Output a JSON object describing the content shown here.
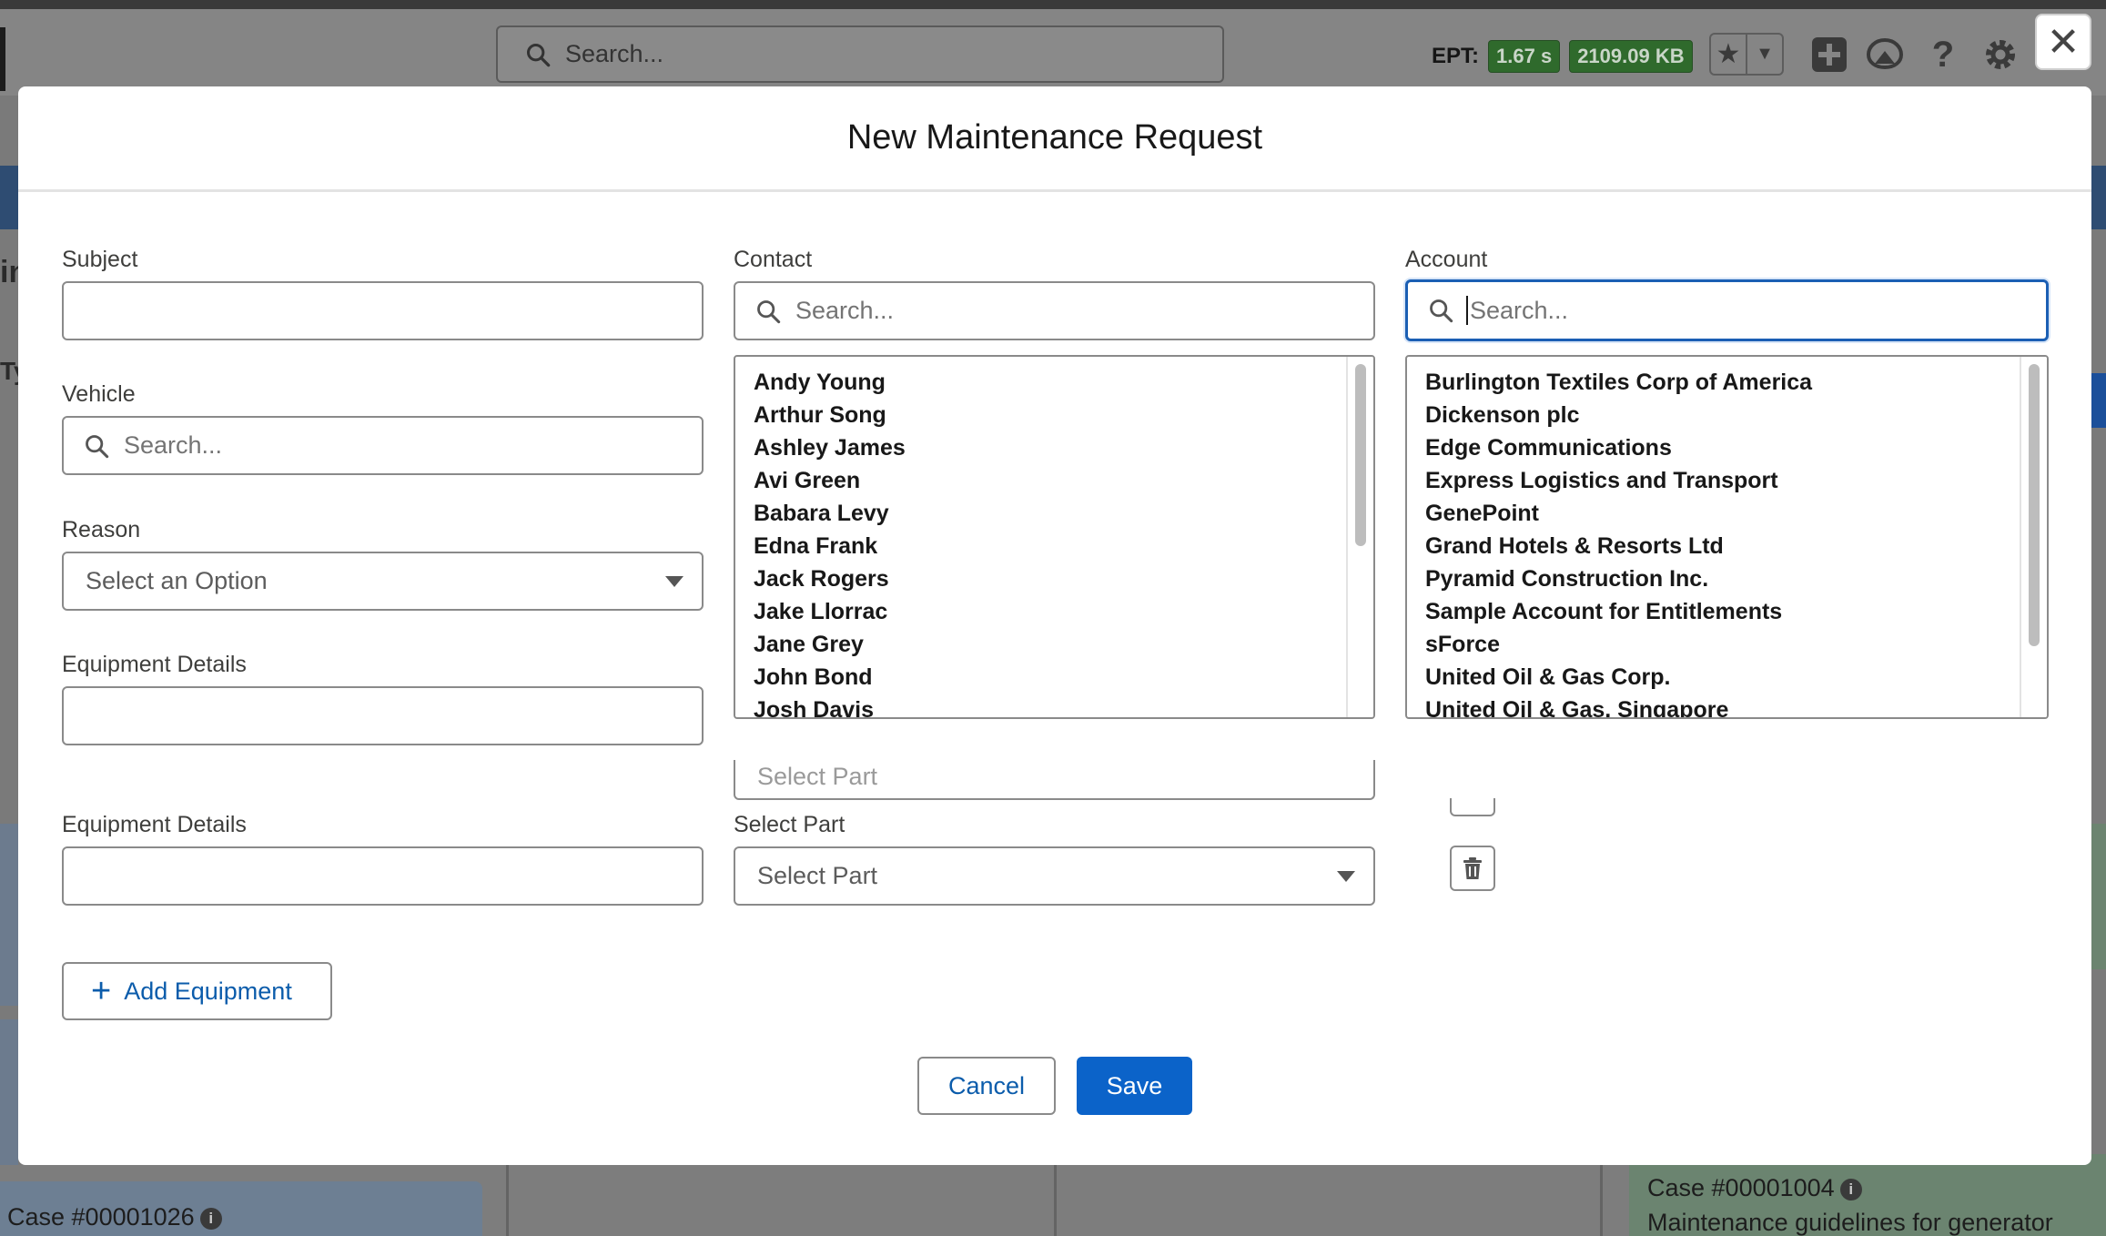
{
  "header": {
    "search_placeholder": "Search...",
    "ept_label": "EPT:",
    "ept_time": "1.67 s",
    "ept_size": "2109.09 KB"
  },
  "background": {
    "left_text_1": "in",
    "left_text_2": "Ty",
    "case_left": "Case #00001026",
    "case_right": "Case #00001004",
    "case_right_desc": "Maintenance guidelines for generator"
  },
  "modal": {
    "title": "New Maintenance Request",
    "subject_label": "Subject",
    "subject_value": "",
    "contact_label": "Contact",
    "contact_placeholder": "Search...",
    "account_label": "Account",
    "account_placeholder": "Search...",
    "vehicle_label": "Vehicle",
    "vehicle_placeholder": "Search...",
    "reason_label": "Reason",
    "reason_placeholder": "Select an Option",
    "equipment_details_label": "Equipment Details",
    "equipment_details_2_label": "Equipment Details",
    "select_part_label": "Select Part",
    "select_part_placeholder": "Select Part",
    "select_part_hidden_placeholder": "Select Part",
    "add_equipment_label": "Add Equipment",
    "cancel_label": "Cancel",
    "save_label": "Save"
  },
  "contact_options": [
    "Andy Young",
    "Arthur Song",
    "Ashley James",
    "Avi Green",
    "Babara Levy",
    "Edna Frank",
    "Jack Rogers",
    "Jake Llorrac",
    "Jane Grey",
    "John Bond",
    "Josh Davis"
  ],
  "account_options": [
    "Burlington Textiles Corp of America",
    "Dickenson plc",
    "Edge Communications",
    "Express Logistics and Transport",
    "GenePoint",
    "Grand Hotels & Resorts Ltd",
    "Pyramid Construction Inc.",
    "Sample Account for Entitlements",
    "sForce",
    "United Oil & Gas Corp.",
    "United Oil & Gas, Singapore"
  ],
  "icons": {
    "search": "search-icon",
    "close": "close-icon",
    "star": "star-icon",
    "add": "add-icon",
    "trailhead": "trailhead-icon",
    "help": "help-icon",
    "settings": "gear-icon",
    "delete": "trash-icon"
  },
  "colors": {
    "brand": "#0b63c9",
    "focus": "#1b5fb4",
    "ept_badge": "#2f6a2c"
  }
}
